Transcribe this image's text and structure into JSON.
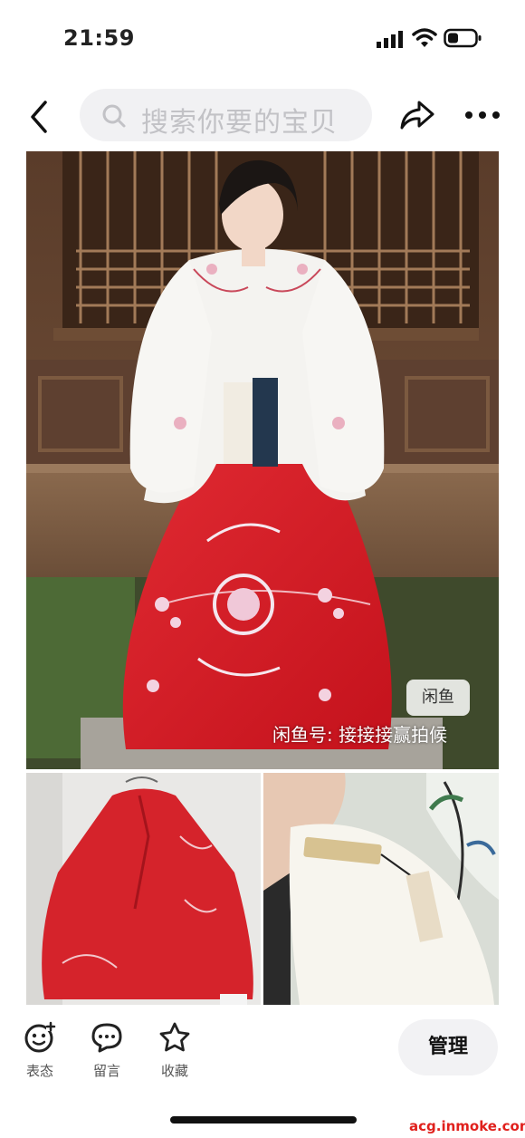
{
  "status_bar": {
    "time": "21:59"
  },
  "nav": {
    "search_placeholder": "搜索你要的宝贝"
  },
  "main_image": {
    "watermark_badge": "闲鱼",
    "watermark_text": "闲鱼号: 接接接赢拍候"
  },
  "actions": [
    {
      "label": "表态"
    },
    {
      "label": "留言"
    },
    {
      "label": "收藏"
    }
  ],
  "manage_label": "管理",
  "site_watermark": "acg.inmoke.com",
  "colors": {
    "skirt_red": "#d41f2a",
    "wood_brown": "#6b4a33"
  }
}
